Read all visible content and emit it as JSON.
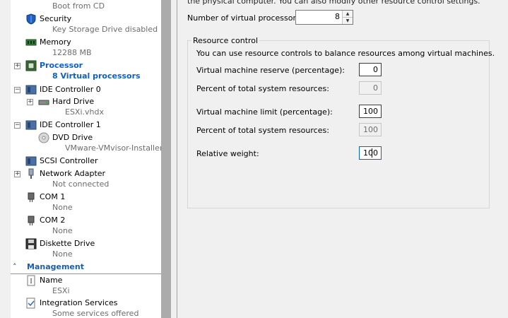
{
  "tree": {
    "firmware_sub": "Boot from CD",
    "security": {
      "label": "Security",
      "sub": "Key Storage Drive disabled"
    },
    "memory": {
      "label": "Memory",
      "sub": "12288 MB"
    },
    "processor": {
      "label": "Processor",
      "sub": "8 Virtual processors"
    },
    "ide0": {
      "label": "IDE Controller 0"
    },
    "hard_drive": {
      "label": "Hard Drive",
      "sub": "ESXi.vhdx"
    },
    "ide1": {
      "label": "IDE Controller 1"
    },
    "dvd_drive": {
      "label": "DVD Drive",
      "sub": "VMware-VMvisor-Installer-..."
    },
    "scsi": {
      "label": "SCSI Controller"
    },
    "network": {
      "label": "Network Adapter",
      "sub": "Not connected"
    },
    "com1": {
      "label": "COM 1",
      "sub": "None"
    },
    "com2": {
      "label": "COM 2",
      "sub": "None"
    },
    "diskette": {
      "label": "Diskette Drive",
      "sub": "None"
    },
    "management_header": "Management",
    "name": {
      "label": "Name",
      "sub": "ESXi"
    },
    "integration": {
      "label": "Integration Services",
      "sub": "Some services offered"
    }
  },
  "content": {
    "intro_text": "the physical computer. You can also modify other resource control settings.",
    "num_vp_label": "Number of virtual processors:",
    "num_vp_value": "8",
    "resource_control_title": "Resource control",
    "resource_control_desc": "You can use resource controls to balance resources among virtual machines.",
    "reserve_label": "Virtual machine reserve (percentage):",
    "reserve_value": "0",
    "reserve_percent_label": "Percent of total system resources:",
    "reserve_percent_value": "0",
    "limit_label": "Virtual machine limit (percentage):",
    "limit_value": "100",
    "limit_percent_label": "Percent of total system resources:",
    "limit_percent_value": "100",
    "weight_label": "Relative weight:",
    "weight_value": "100"
  },
  "colors": {
    "selected_text": "#0b62c4",
    "section_header": "#1a5db0",
    "secondary_text": "#6d6d6d"
  },
  "icons": [
    "shield-icon",
    "memory-chip-icon",
    "processor-icon",
    "ide-controller-icon",
    "hard-drive-icon",
    "dvd-icon",
    "scsi-controller-icon",
    "network-adapter-icon",
    "com-port-icon",
    "diskette-icon",
    "name-icon",
    "integration-services-icon",
    "chevron-up-icon"
  ]
}
